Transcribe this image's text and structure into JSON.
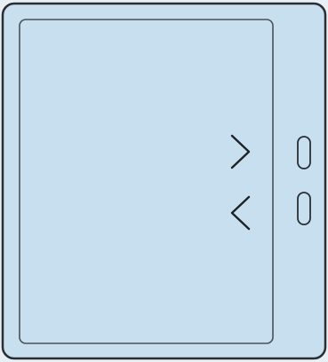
{
  "device": {
    "body_color": "#c8dff0",
    "outline_color": "#2a2e33",
    "screen_stroke": "#4a5158",
    "glyph_color": "#1f2327",
    "background": "#e9f0f5"
  },
  "controls": {
    "next_icon": "chevron-right-icon",
    "previous_icon": "chevron-left-icon",
    "upper_button": "page-turn-button-upper",
    "lower_button": "page-turn-button-lower"
  }
}
